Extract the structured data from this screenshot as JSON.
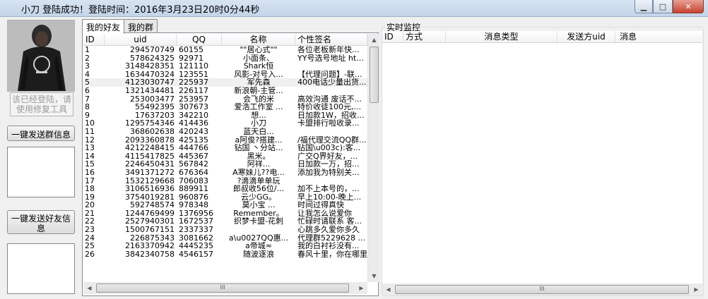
{
  "window": {
    "title": "小刀 登陆成功！登陆时间：2016年3月23日20时0分44秒",
    "min_icon": "minimize-icon",
    "max_icon": "maximize-icon",
    "close_icon": "close-icon"
  },
  "left": {
    "avatar_caption": "该已经登陆，请使用修复工具",
    "status_button": "请使用修复工具",
    "send_group_button": "一键发送群信息",
    "send_friend_button": "一键发送好友信息"
  },
  "tabs": [
    {
      "label": "我的好友",
      "active": true
    },
    {
      "label": "我的群",
      "active": false
    }
  ],
  "friends": {
    "columns": [
      "ID",
      "uid",
      "QQ",
      "名称",
      "个性签名"
    ],
    "rows": [
      [
        "1",
        "294570749",
        "60155",
        "\"\"居心式\"\"",
        "各位老板新年快..."
      ],
      [
        "2",
        "578624325",
        "92971",
        "小面条、",
        "YY号选号地址 ht..."
      ],
      [
        "3",
        "3148428351",
        "121110",
        "Shark恒",
        ""
      ],
      [
        "4",
        "1634470324",
        "123551",
        "风影-对号入...",
        "【代理问题】-联..."
      ],
      [
        "5",
        "4123030747",
        "225937",
        "军先森",
        "400电话少量出货..."
      ],
      [
        "6",
        "1321434481",
        "226117",
        "新浪朝-主管...",
        ""
      ],
      [
        "7",
        "253003477",
        "253957",
        "会飞的米",
        "高效沟通 废话不..."
      ],
      [
        "8",
        "55492395",
        "307673",
        "爱浩工作室 ...",
        "特价收徒100元,..."
      ],
      [
        "9",
        "17637203",
        "342210",
        "想...",
        "日加款1W，招收..."
      ],
      [
        "10",
        "1295754346",
        "414436",
        "小刀",
        "卡盟排行啦收录..."
      ],
      [
        "11",
        "368602638",
        "420243",
        "蓝天白...",
        ""
      ],
      [
        "12",
        "2093360878",
        "425135",
        "a阿俊?搭建...",
        "/福代理交流QQ群..."
      ],
      [
        "13",
        "4212248415",
        "444766",
        "钻国 丶分站...",
        "钻国\\u003c):客..."
      ],
      [
        "14",
        "4115417825",
        "445367",
        "黑米。",
        "广交Q界好友，..."
      ],
      [
        "15",
        "2246450431",
        "567842",
        "阿祥...",
        "日加款一万，招..."
      ],
      [
        "16",
        "3491371272",
        "676364",
        "A寒妹儿??电...",
        "添加我为特别关..."
      ],
      [
        "17",
        "1532129668",
        "706083",
        "?滴滴单单玩",
        ""
      ],
      [
        "18",
        "3106516936",
        "889911",
        "郎叔收56位/...",
        "加不上本号的，..."
      ],
      [
        "19",
        "3754019281",
        "960876",
        "云少GG。",
        "早上10:00-晚上..."
      ],
      [
        "20",
        "592748574",
        "978348",
        "莫小宝 ...",
        "时间过得真快"
      ],
      [
        "21",
        "1244769499",
        "1376956",
        "Remember。",
        "让我怎么说爱你"
      ],
      [
        "22",
        "2527940301",
        "1672537",
        "织梦卡盟-花刺",
        "忙碌时请联系 客..."
      ],
      [
        "23",
        "1500767151",
        "2337337",
        "",
        "心跳多久爱你多久"
      ],
      [
        "24",
        "226875343",
        "3081662",
        "a\\u0027QQ惠...",
        "代理群5229628 ..."
      ],
      [
        "25",
        "2163370942",
        "4445235",
        "a帝城≈",
        "我的白衬衫没有..."
      ],
      [
        "26",
        "3842340758",
        "4546157",
        "随波逐浪",
        "春风十里，你在哪里"
      ]
    ]
  },
  "monitor": {
    "group_label": "实时监控",
    "columns": [
      "ID",
      "方式",
      "消息类型",
      "发送方uid",
      "消息"
    ]
  },
  "scroll": {
    "grip": "III"
  }
}
